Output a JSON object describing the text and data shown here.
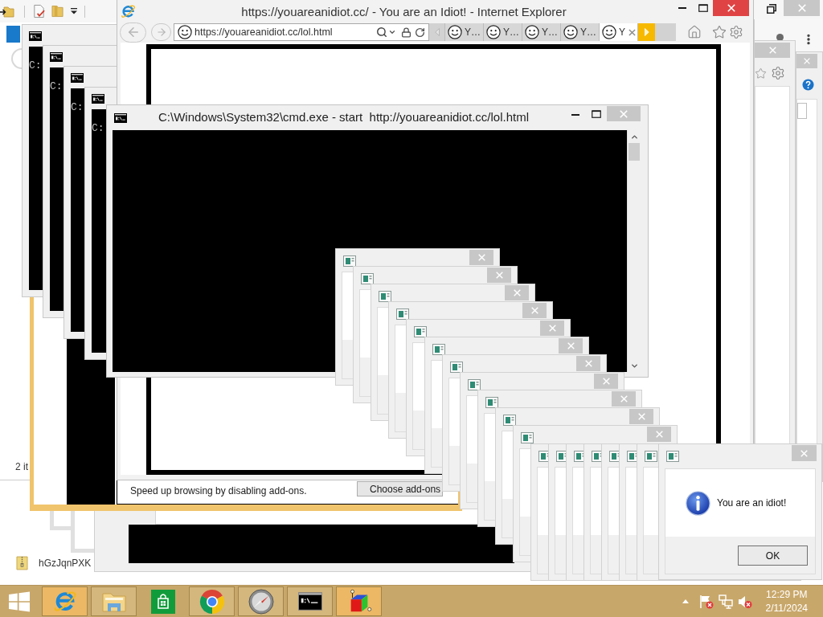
{
  "explorer_window": {
    "status_text": "2 it"
  },
  "desktop_icons": [
    {
      "label": "hGzJqnPXK"
    }
  ],
  "ie_window": {
    "title": "https://youareanidiot.cc/ - You are an Idiot! - Internet Explorer",
    "address": "https://youareanidiot.cc/lol.html",
    "tabs": [
      {
        "label": "Y…",
        "selected": false
      },
      {
        "label": "Y…",
        "selected": false
      },
      {
        "label": "Y…",
        "selected": false
      },
      {
        "label": "Y…",
        "selected": false
      },
      {
        "label": "Y",
        "selected": true
      }
    ]
  },
  "addon_notification": {
    "message": "Speed up browsing by disabling add-ons.",
    "button": "Choose add-ons"
  },
  "cmd_windows": [
    {
      "prompt": "C:"
    },
    {
      "prompt": "C:"
    },
    {
      "prompt": "C:"
    },
    {
      "prompt": "C:"
    }
  ],
  "cmd_main": {
    "title": "C:\\Windows\\System32\\cmd.exe - start  http://youareanidiot.cc/lol.html"
  },
  "message_box": {
    "text": "You are an idiot!",
    "button": "OK"
  },
  "taskbar": {
    "apps": [
      {
        "kind": "e_browser",
        "running": true,
        "highlighted": true
      },
      {
        "kind": "folder",
        "running": true,
        "highlighted": false
      },
      {
        "kind": "store",
        "running": false,
        "highlighted": false
      },
      {
        "kind": "ring_browser",
        "running": true,
        "highlighted": false
      },
      {
        "kind": "compass",
        "running": true,
        "highlighted": false
      },
      {
        "kind": "terminal",
        "running": true,
        "highlighted": false
      },
      {
        "kind": "cube",
        "running": true,
        "highlighted": true
      }
    ],
    "clock": {
      "time": "12:29 PM",
      "date": "2/11/2024"
    }
  }
}
